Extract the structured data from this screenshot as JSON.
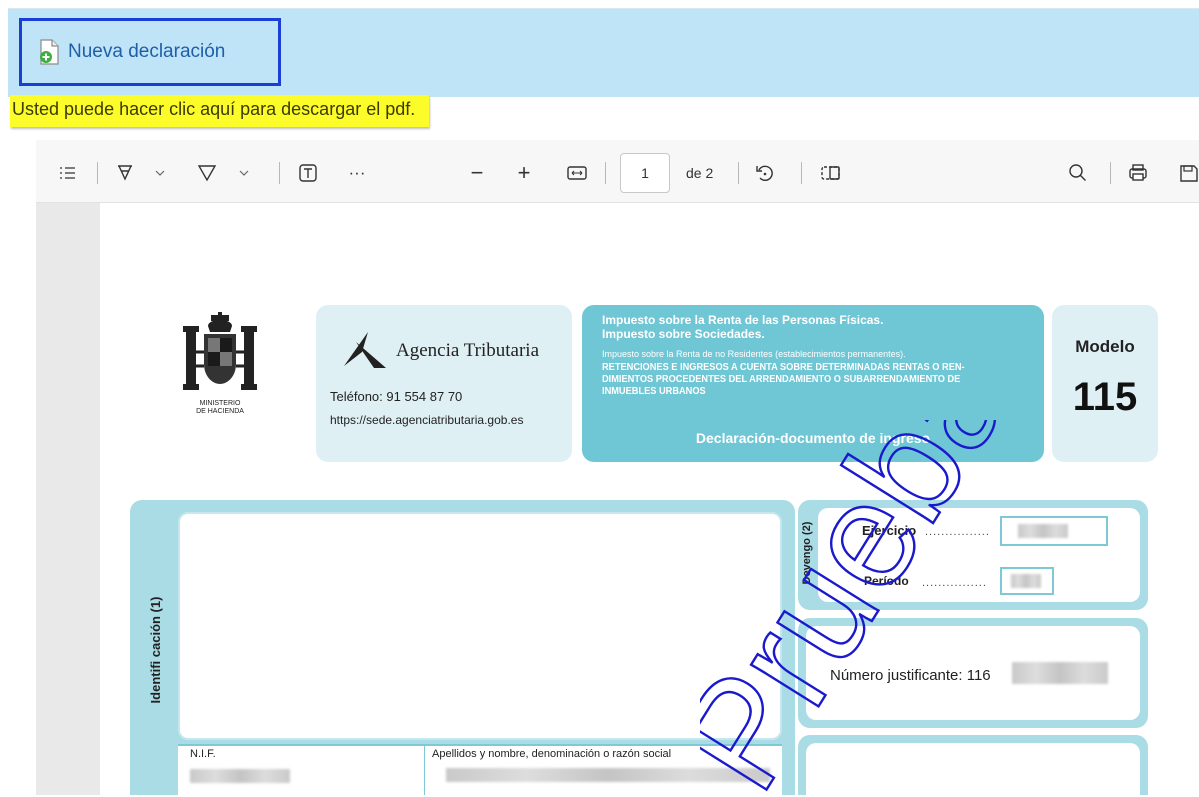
{
  "toolbar_top": {
    "new_declaration": "Nueva declaración"
  },
  "tooltip": "Usted puede hacer clic aquí para descargar el pdf.",
  "pdf_viewer": {
    "page_current": "1",
    "page_of": "de 2",
    "icons": [
      "contents-icon",
      "highlight-icon",
      "chevron-down-icon",
      "draw-icon",
      "chevron-down-icon",
      "text-icon",
      "more-icon",
      "zoom-out-icon",
      "zoom-in-icon",
      "fit-page-icon",
      "rotate-icon",
      "page-view-icon",
      "search-icon",
      "print-icon",
      "save-icon"
    ],
    "zoom_out": "−",
    "zoom_in": "+",
    "more": "···"
  },
  "document": {
    "ministry": "MINISTERIO\nDE HACIENDA",
    "agency": {
      "name": "Agencia Tributaria",
      "phone": "Teléfono: 91 554 87 70",
      "url": "https://sede.agenciatributaria.gob.es"
    },
    "taxes": {
      "line1": "Impuesto sobre la Renta de las Personas Físicas.",
      "line2": "Impuesto sobre Sociedades.",
      "line3": "Impuesto sobre la Renta de no Residentes (establecimientos permanentes).",
      "line4a": "RETENCIONES E INGRESOS A CUENTA SOBRE DETERMINADAS RENTAS O REN-",
      "line4b": "DIMIENTOS PROCEDENTES DEL ARRENDAMIENTO O SUBARRENDAMIENTO DE",
      "line4c": "INMUEBLES URBANOS",
      "doc_type": "Declaración-documento de ingreso"
    },
    "model": {
      "label": "Modelo",
      "number": "115"
    },
    "identification": {
      "label": "Identifi cación (1)",
      "nif_label": "N.I.F.",
      "name_label": "Apellidos y nombre, denominación o razón social"
    },
    "accrual": {
      "label": "Devengo (2)",
      "year_label": "Ejercicio",
      "period_label": "Período",
      "dots": "................"
    },
    "receipt": {
      "label": "Número justificante: 116"
    },
    "watermark": "Pruebas"
  },
  "colors": {
    "banner": "#bfe3f7",
    "focus_border": "#1a3fd6",
    "tooltip_bg": "#fcfc2a",
    "teal": "#6fc6d4",
    "teal_light": "#dff0f4",
    "watermark": "#1a1acc"
  }
}
